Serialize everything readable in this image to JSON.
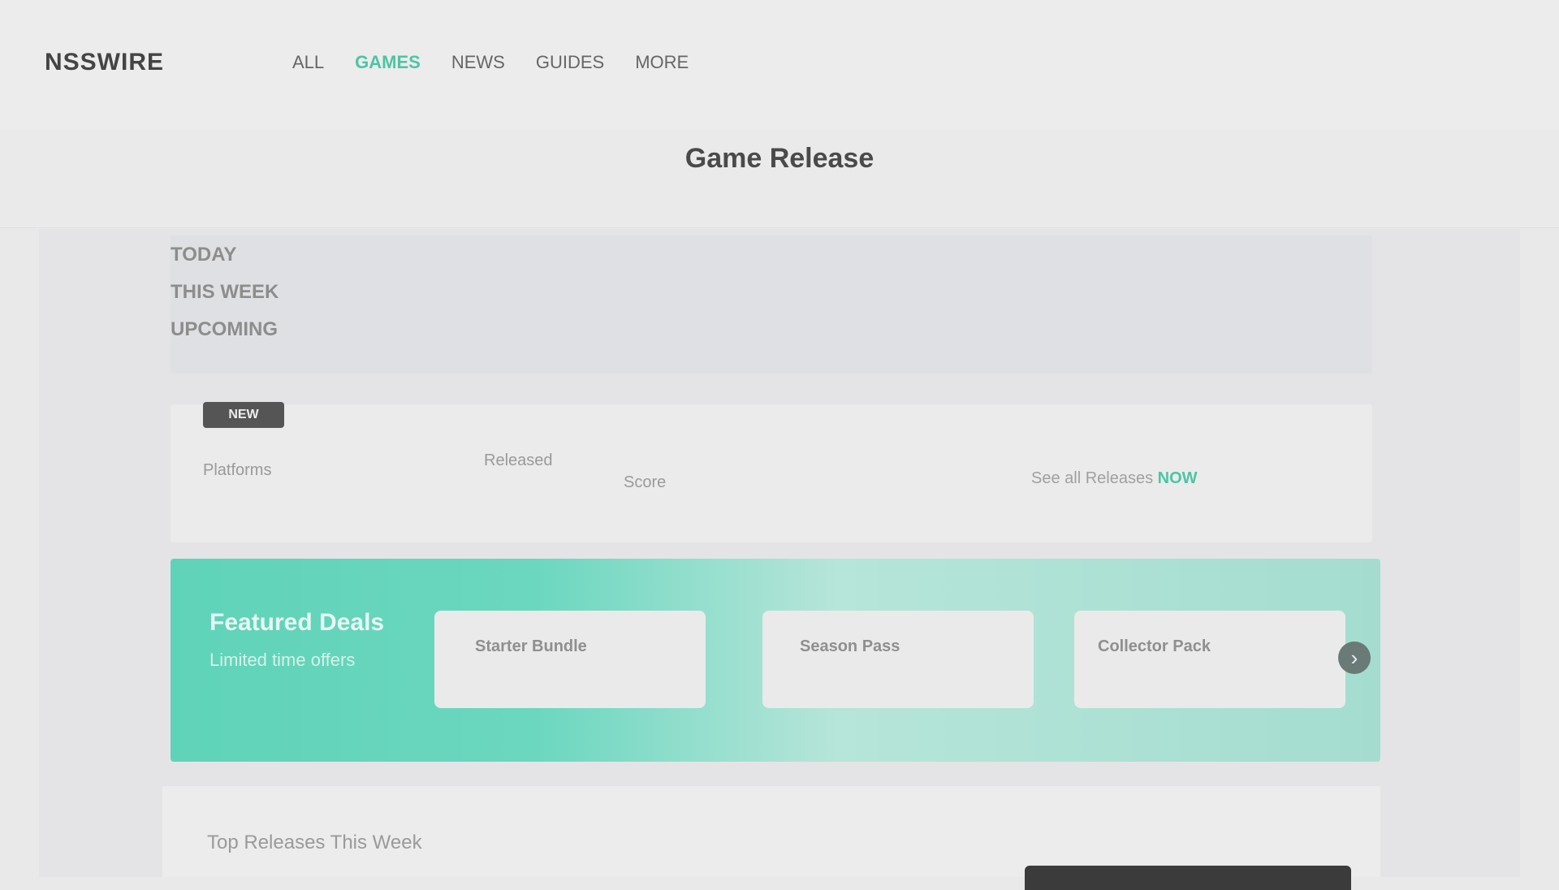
{
  "nav": {
    "logo": "NSSWIRE",
    "links": [
      {
        "label": "ALL",
        "active": false
      },
      {
        "label": "GAMES",
        "active": true
      },
      {
        "label": "NEWS",
        "active": false
      },
      {
        "label": "GUIDES",
        "active": false
      },
      {
        "label": "MORE",
        "active": false
      }
    ]
  },
  "page": {
    "title": "Game Release"
  },
  "side_labels": [
    "TODAY",
    "THIS WEEK",
    "UPCOMING"
  ],
  "card": {
    "badge": "NEW",
    "subtitle": "Platforms",
    "stat1": "Released",
    "stat2": "Score",
    "action_prefix": "See all Releases",
    "action_link": "NOW"
  },
  "promo": {
    "title": "Featured Deals",
    "subtitle": "Limited time offers",
    "slots": [
      "Starter Bundle",
      "Season Pass",
      "Collector Pack"
    ],
    "arrow": "›"
  },
  "list": {
    "heading": "Top Releases This Week"
  },
  "colors": {
    "accent": "#4cc5a4",
    "promo_gradient_start": "#5fd3b8",
    "promo_gradient_end": "#a4ddd0"
  }
}
